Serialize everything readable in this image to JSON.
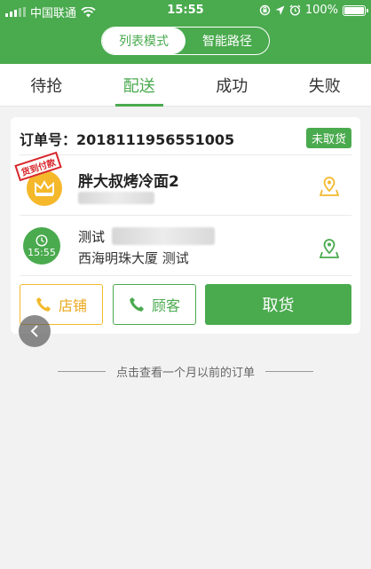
{
  "status_bar": {
    "carrier": "中国联通",
    "time": "15:55",
    "battery": "100%",
    "battery_level": 1.0
  },
  "mode_toggle": {
    "list_mode": "列表模式",
    "smart_route": "智能路径",
    "active": "list_mode"
  },
  "tabs": [
    {
      "label": "待抢"
    },
    {
      "label": "配送",
      "active": true
    },
    {
      "label": "成功"
    },
    {
      "label": "失败"
    }
  ],
  "order": {
    "number_label": "订单号：2018111956551005",
    "status": "未取货",
    "shop": {
      "name": "胖大叔烤冷面2",
      "stamp": "货到付款"
    },
    "customer": {
      "name": "测试",
      "time": "15:55",
      "address": "西海明珠大厦 测试"
    },
    "buttons": {
      "store": "店铺",
      "customer": "顾客",
      "pickup": "取货"
    }
  },
  "history_link": "点击查看一个月以前的订单",
  "colors": {
    "brand": "#4aaa4e",
    "store_accent": "#f3b92c",
    "stamp": "#d8262b"
  }
}
